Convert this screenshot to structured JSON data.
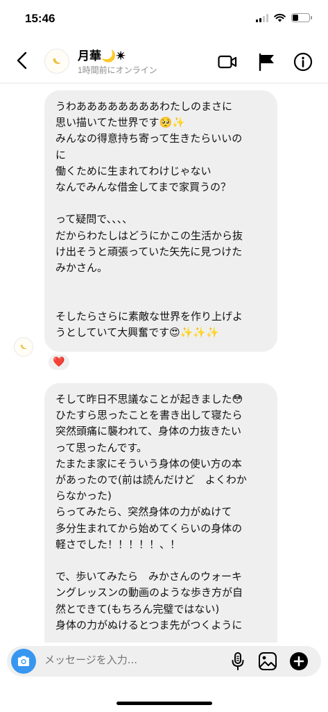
{
  "status_bar": {
    "time": "15:46"
  },
  "header": {
    "name": "月華🌙✴︎",
    "status": "1時間前にオンライン",
    "icons": [
      "back-arrow-icon",
      "video-call-icon",
      "flag-icon",
      "info-icon"
    ]
  },
  "messages": [
    {
      "lines": [
        "うわああああああああわたしのまさに",
        "思い描いてた世界です🥺✨",
        "みんなの得意持ち寄って生きたらいいの",
        "に",
        "働くために生まれてわけじゃない",
        "なんでみんな借金してまで家買うの？",
        "",
        "って疑問で、、、、",
        "だからわたしはどうにかこの生活から抜",
        "け出そうと頑張っていた矢先に見つけた",
        "みかさん。",
        "",
        "",
        "そしたらさらに素敵な世界を作り上げよ",
        "うとしていて大興奮です😍✨✨✨"
      ],
      "reaction": "❤️"
    },
    {
      "lines": [
        "そして昨日不思議なことが起きました😳",
        "ひたすら思ったことを書き出して寝たら",
        "突然頭痛に襲われて、身体の力抜きたい",
        "って思ったんです。",
        "たまたま家にそういう身体の使い方の本",
        "があったので(前は読んだけど　よくわか",
        "らなかった)",
        "らってみたら、突然身体の力がぬけて",
        "多分生まれてから始めてくらいの身体の",
        "軽さでした！！！！！、！",
        "",
        "で、歩いてみたら　みかさんのウォーキ",
        "ングレッスンの動画のような歩き方が自",
        "然とできて(もちろん完璧ではない)",
        "身体の力がぬけるとつま先がつくように"
      ]
    }
  ],
  "composer": {
    "placeholder": "メッセージを入力...",
    "icons": [
      "camera-icon",
      "microphone-icon",
      "gallery-icon",
      "add-icon"
    ]
  }
}
